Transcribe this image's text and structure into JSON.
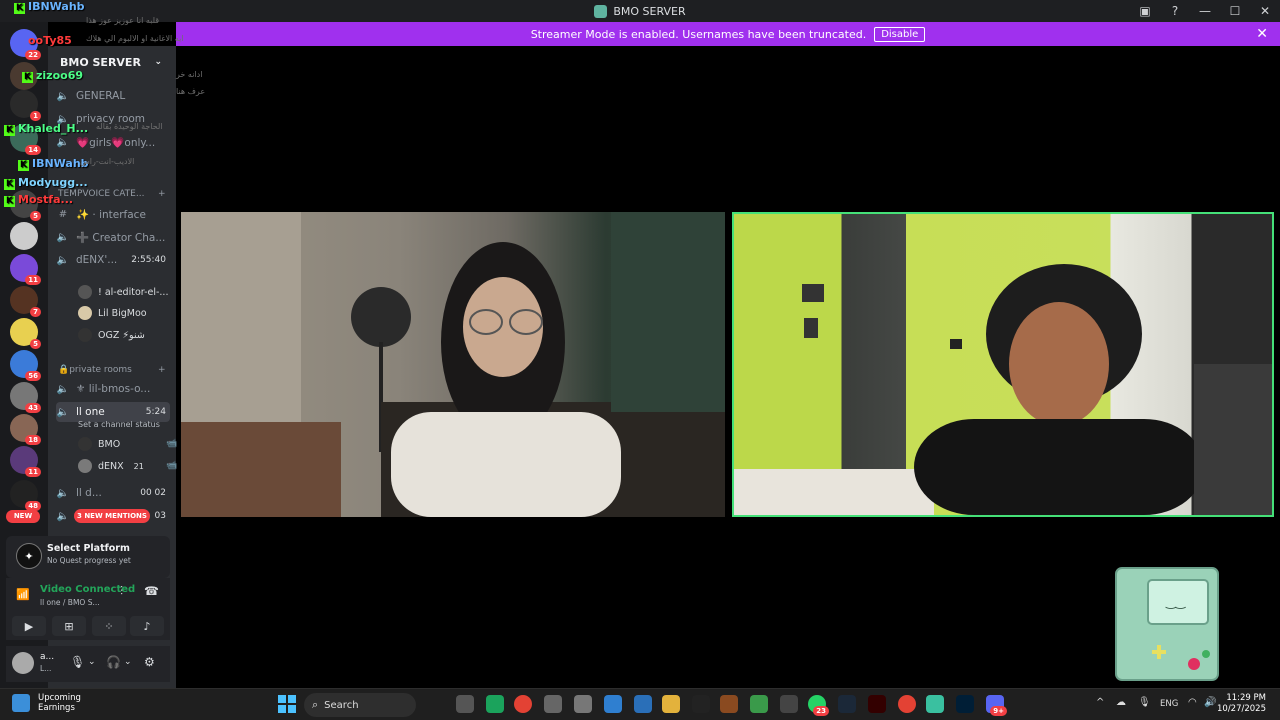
{
  "app": {
    "window_title": "BMO SERVER"
  },
  "streamer_banner": {
    "text": "Streamer Mode is enabled. Usernames have been truncated.",
    "disable_label": "Disable"
  },
  "guild_badges": [
    "22",
    "1",
    "14",
    "5",
    "11",
    "7",
    "5",
    "56",
    "43",
    "18",
    "11",
    "48"
  ],
  "new_label": "NEW",
  "server": {
    "name": "BMO SERVER"
  },
  "channels": {
    "general": "GENERAL",
    "privacy": "privacy room",
    "girls": "💗girls💗only...",
    "category_tempvoice": "TEMPVOICE CATE...",
    "interface": "✨ · interface",
    "creator": "➕ Creator Cha...",
    "denx": "dENX'...",
    "denx_time": "2:55:40",
    "category_private": "🔒private rooms",
    "lil_bmos": "⚜ lil-bmos-o...",
    "one": "ll one",
    "one_time": "5:24",
    "channel_status": "Set a channel status",
    "d_channel": "ll d...",
    "d_counts": "00  02",
    "last_count": "03",
    "mentions": "3 NEW MENTIONS"
  },
  "members": {
    "editor": "! al-editor-el-...",
    "bigmoo": "Lil BigMoo",
    "ogz": "OGZ ⚡شنو",
    "bmo": "BMO",
    "denx_member": "dENX",
    "denx_count": "21"
  },
  "overlay_names": [
    "IBNWahb",
    "ooTy85",
    "zizoo69",
    "Khaled_H...",
    "IBNWahb",
    "Modyugg...",
    "Mostfa..."
  ],
  "faint_chat": [
    "قلبه انا عوزيز عوز هذا",
    "ايه الاغانية او الالبوم الي هلاك",
    "ادانه خر",
    "عرف هنا",
    "الحاجة الوحيدة بقاله",
    "الاديب-انت-راس"
  ],
  "quest": {
    "title": "Select Platform",
    "subtitle": "No Quest progress yet"
  },
  "voice": {
    "status": "Video Connected",
    "location": "ll one / BMO S..."
  },
  "user": {
    "name": "a...",
    "status": "L..."
  },
  "taskbar": {
    "widget_title": "Upcoming",
    "widget_sub": "Earnings",
    "search_placeholder": "Search",
    "language": "ENG",
    "time": "11:29 PM",
    "date": "10/27/2025",
    "whatsapp_badge": "23",
    "discord_badge": "9+"
  },
  "colors": {
    "accent_streamer": "#a030ee",
    "online_green": "#23a55a",
    "mention_red": "#f23f43",
    "speaking_border": "#45e078"
  }
}
